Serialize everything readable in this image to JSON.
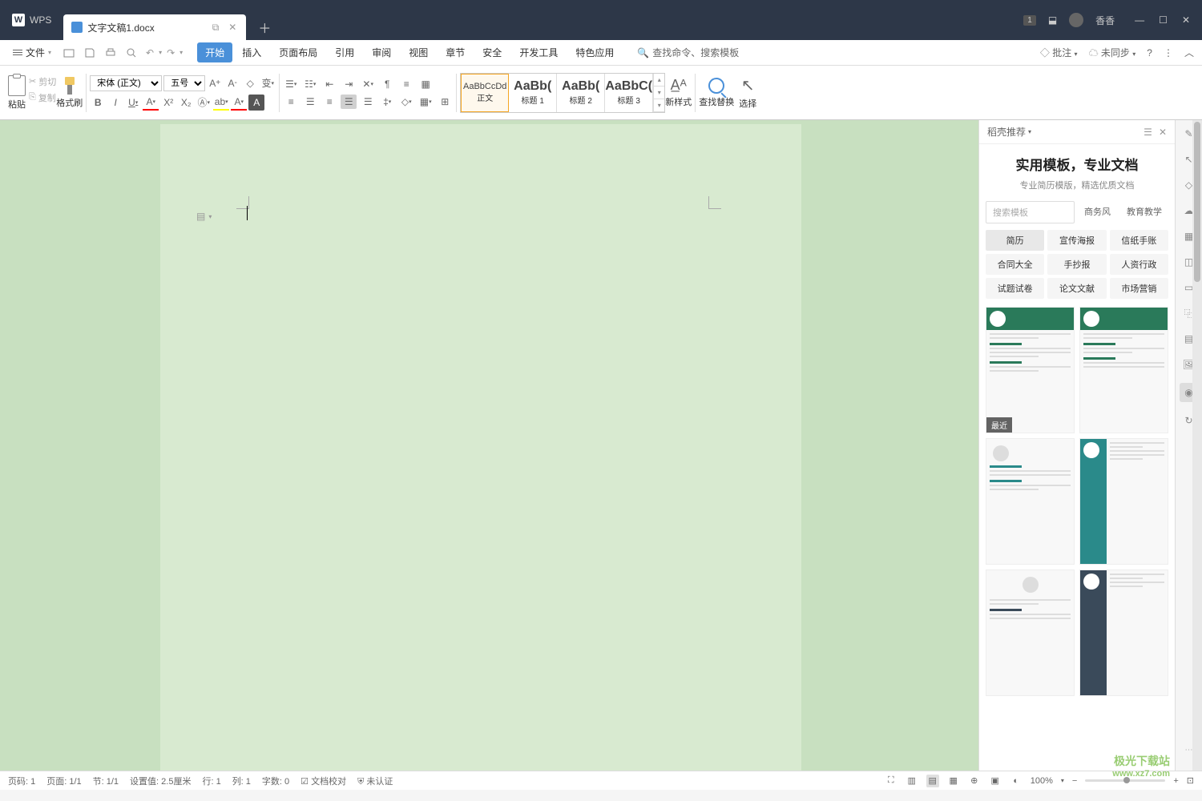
{
  "app": {
    "name": "WPS",
    "tab_name": "文字文稿1.docx",
    "user_name": "香香",
    "badge": "1"
  },
  "menubar": {
    "file": "文件",
    "tabs": [
      "开始",
      "插入",
      "页面布局",
      "引用",
      "审阅",
      "视图",
      "章节",
      "安全",
      "开发工具",
      "特色应用"
    ],
    "active_tab": 0,
    "search": "查找命令、搜索模板",
    "annotate": "批注",
    "sync": "未同步"
  },
  "ribbon": {
    "paste": "粘贴",
    "cut": "剪切",
    "copy": "复制",
    "format_painter": "格式刷",
    "font_name": "宋体 (正文)",
    "font_size": "五号",
    "new_style": "新样式",
    "find_replace": "查找替换",
    "select": "选择",
    "styles": [
      {
        "preview": "AaBbCcDd",
        "label": "正文",
        "class": ""
      },
      {
        "preview": "AaBb(",
        "label": "标题 1",
        "class": "big"
      },
      {
        "preview": "AaBb(",
        "label": "标题 2",
        "class": "big"
      },
      {
        "preview": "AaBbC(",
        "label": "标题 3",
        "class": "big"
      }
    ]
  },
  "sidebar": {
    "panel_title": "稻壳推荐",
    "promo_title": "实用模板，专业文档",
    "promo_sub": "专业简历模版，精选优质文档",
    "search_placeholder": "搜索模板",
    "search_tags": [
      "商务风",
      "教育教学"
    ],
    "categories": [
      "简历",
      "宣传海报",
      "信纸手账",
      "合同大全",
      "手抄报",
      "人资行政",
      "试题试卷",
      "论文文献",
      "市场营销"
    ],
    "active_category": 0,
    "recent_badge": "最近"
  },
  "statusbar": {
    "page_no": "页码: 1",
    "page": "页面: 1/1",
    "section": "节: 1/1",
    "setting": "设置值: 2.5厘米",
    "row": "行: 1",
    "col": "列: 1",
    "words": "字数: 0",
    "proofing": "文档校对",
    "unverified": "未认证",
    "zoom": "100%"
  },
  "watermark": {
    "brand": "极光下载站",
    "url": "www.xz7.com"
  }
}
